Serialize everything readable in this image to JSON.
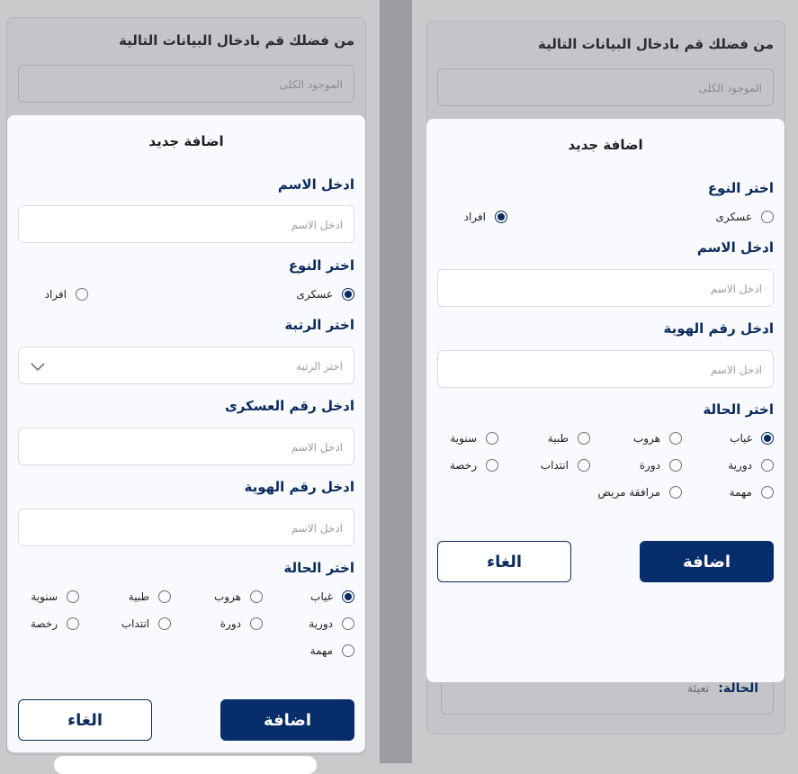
{
  "background": {
    "title": "من فضلك قم  بادخال البيانات التالية",
    "total_placeholder": "الموجود الكلى",
    "status_label": "الحالة:",
    "status_value": "تعبئة"
  },
  "left_modal": {
    "title": "اضافة جديد",
    "name_label": "ادخل الاسم",
    "name_placeholder": "ادخل الاسم",
    "type_label": "اختر النوع",
    "type_options": [
      "عسكرى",
      "افراد"
    ],
    "rank_label": "اختر الرتبة",
    "rank_placeholder": "اختر الرتبة",
    "military_number_label": "ادخل رقم العسكرى",
    "military_number_placeholder": "ادخل الاسم",
    "id_label": "ادخل رقم الهوية",
    "id_placeholder": "ادخل الاسم",
    "status_label": "اختر الحالة",
    "status_options": [
      "غياب",
      "هروب",
      "طبية",
      "سنوية",
      "دورية",
      "دورة",
      "انتداب",
      "رخصة",
      "مهمة"
    ],
    "add_label": "اضافة",
    "cancel_label": "الغاء"
  },
  "right_modal": {
    "title": "اضافة جديد",
    "type_label": "اختر النوع",
    "type_options": [
      "عسكرى",
      "افراد"
    ],
    "name_label": "ادخل الاسم",
    "name_placeholder": "ادخل الاسم",
    "id_label": "ادخل رقم الهوية",
    "id_placeholder": "ادخل الاسم",
    "status_label": "اختر الحالة",
    "status_options": [
      "غياب",
      "هروب",
      "طبية",
      "سنوية",
      "دورية",
      "دورة",
      "انتداب",
      "رخصة",
      "مهمة",
      "مرافقة مريض"
    ],
    "add_label": "اضافة",
    "cancel_label": "الغاء"
  },
  "colors": {
    "primary": "#082d6b",
    "label": "#0b2a5e",
    "panel": "#f8fafd",
    "overlay": "#c9cacc"
  }
}
